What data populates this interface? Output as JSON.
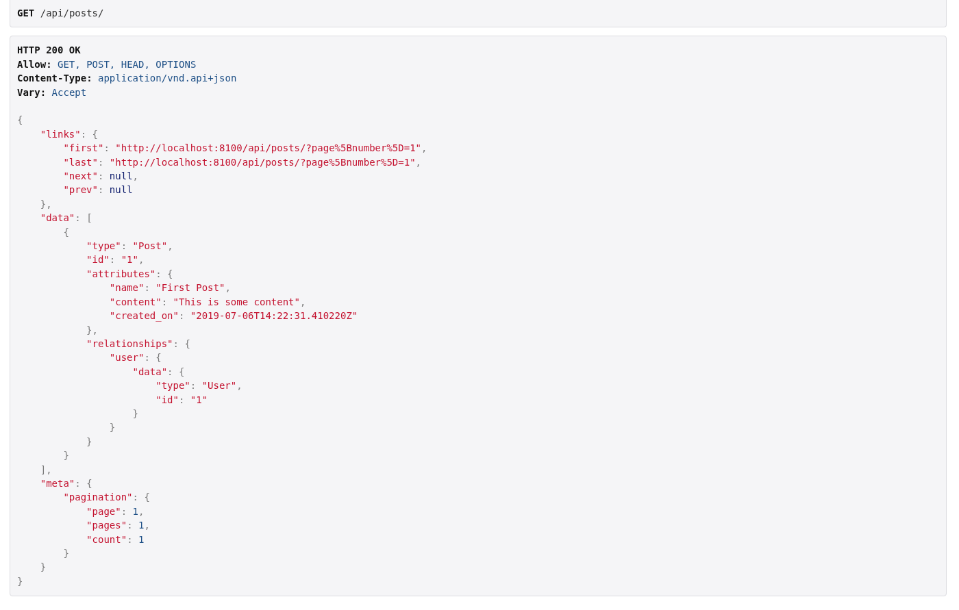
{
  "request": {
    "method": "GET",
    "path": "/api/posts/"
  },
  "response": {
    "status": "HTTP 200 OK",
    "headers": [
      {
        "name": "Allow:",
        "value": "GET, POST, HEAD, OPTIONS"
      },
      {
        "name": "Content-Type:",
        "value": "application/vnd.api+json"
      },
      {
        "name": "Vary:",
        "value": "Accept"
      }
    ],
    "body": {
      "tokens": [
        {
          "kind": "punct",
          "text": "{"
        }
      ],
      "close": [
        {
          "kind": "punct",
          "text": "}"
        }
      ],
      "children": [
        {
          "tokens": [
            {
              "kind": "key",
              "text": "\"links\""
            },
            {
              "kind": "punct",
              "text": ": {"
            }
          ],
          "close": [
            {
              "kind": "punct",
              "text": "},"
            }
          ],
          "children": [
            {
              "tokens": [
                {
                  "kind": "key",
                  "text": "\"first\""
                },
                {
                  "kind": "punct",
                  "text": ": "
                },
                {
                  "kind": "string",
                  "text": "\"http://localhost:8100/api/posts/?page%5Bnumber%5D=1\""
                },
                {
                  "kind": "punct",
                  "text": ","
                }
              ]
            },
            {
              "tokens": [
                {
                  "kind": "key",
                  "text": "\"last\""
                },
                {
                  "kind": "punct",
                  "text": ": "
                },
                {
                  "kind": "string",
                  "text": "\"http://localhost:8100/api/posts/?page%5Bnumber%5D=1\""
                },
                {
                  "kind": "punct",
                  "text": ","
                }
              ]
            },
            {
              "tokens": [
                {
                  "kind": "key",
                  "text": "\"next\""
                },
                {
                  "kind": "punct",
                  "text": ": "
                },
                {
                  "kind": "null",
                  "text": "null"
                },
                {
                  "kind": "punct",
                  "text": ","
                }
              ]
            },
            {
              "tokens": [
                {
                  "kind": "key",
                  "text": "\"prev\""
                },
                {
                  "kind": "punct",
                  "text": ": "
                },
                {
                  "kind": "null",
                  "text": "null"
                }
              ]
            }
          ]
        },
        {
          "tokens": [
            {
              "kind": "key",
              "text": "\"data\""
            },
            {
              "kind": "punct",
              "text": ": ["
            }
          ],
          "close": [
            {
              "kind": "punct",
              "text": "],"
            }
          ],
          "children": [
            {
              "tokens": [
                {
                  "kind": "punct",
                  "text": "{"
                }
              ],
              "close": [
                {
                  "kind": "punct",
                  "text": "}"
                }
              ],
              "children": [
                {
                  "tokens": [
                    {
                      "kind": "key",
                      "text": "\"type\""
                    },
                    {
                      "kind": "punct",
                      "text": ": "
                    },
                    {
                      "kind": "string",
                      "text": "\"Post\""
                    },
                    {
                      "kind": "punct",
                      "text": ","
                    }
                  ]
                },
                {
                  "tokens": [
                    {
                      "kind": "key",
                      "text": "\"id\""
                    },
                    {
                      "kind": "punct",
                      "text": ": "
                    },
                    {
                      "kind": "string",
                      "text": "\"1\""
                    },
                    {
                      "kind": "punct",
                      "text": ","
                    }
                  ]
                },
                {
                  "tokens": [
                    {
                      "kind": "key",
                      "text": "\"attributes\""
                    },
                    {
                      "kind": "punct",
                      "text": ": {"
                    }
                  ],
                  "close": [
                    {
                      "kind": "punct",
                      "text": "},"
                    }
                  ],
                  "children": [
                    {
                      "tokens": [
                        {
                          "kind": "key",
                          "text": "\"name\""
                        },
                        {
                          "kind": "punct",
                          "text": ": "
                        },
                        {
                          "kind": "string",
                          "text": "\"First Post\""
                        },
                        {
                          "kind": "punct",
                          "text": ","
                        }
                      ]
                    },
                    {
                      "tokens": [
                        {
                          "kind": "key",
                          "text": "\"content\""
                        },
                        {
                          "kind": "punct",
                          "text": ": "
                        },
                        {
                          "kind": "string",
                          "text": "\"This is some content\""
                        },
                        {
                          "kind": "punct",
                          "text": ","
                        }
                      ]
                    },
                    {
                      "tokens": [
                        {
                          "kind": "key",
                          "text": "\"created_on\""
                        },
                        {
                          "kind": "punct",
                          "text": ": "
                        },
                        {
                          "kind": "string",
                          "text": "\"2019-07-06T14:22:31.410220Z\""
                        }
                      ]
                    }
                  ]
                },
                {
                  "tokens": [
                    {
                      "kind": "key",
                      "text": "\"relationships\""
                    },
                    {
                      "kind": "punct",
                      "text": ": {"
                    }
                  ],
                  "close": [
                    {
                      "kind": "punct",
                      "text": "}"
                    }
                  ],
                  "children": [
                    {
                      "tokens": [
                        {
                          "kind": "key",
                          "text": "\"user\""
                        },
                        {
                          "kind": "punct",
                          "text": ": {"
                        }
                      ],
                      "close": [
                        {
                          "kind": "punct",
                          "text": "}"
                        }
                      ],
                      "children": [
                        {
                          "tokens": [
                            {
                              "kind": "key",
                              "text": "\"data\""
                            },
                            {
                              "kind": "punct",
                              "text": ": {"
                            }
                          ],
                          "close": [
                            {
                              "kind": "punct",
                              "text": "}"
                            }
                          ],
                          "children": [
                            {
                              "tokens": [
                                {
                                  "kind": "key",
                                  "text": "\"type\""
                                },
                                {
                                  "kind": "punct",
                                  "text": ": "
                                },
                                {
                                  "kind": "string",
                                  "text": "\"User\""
                                },
                                {
                                  "kind": "punct",
                                  "text": ","
                                }
                              ]
                            },
                            {
                              "tokens": [
                                {
                                  "kind": "key",
                                  "text": "\"id\""
                                },
                                {
                                  "kind": "punct",
                                  "text": ": "
                                },
                                {
                                  "kind": "string",
                                  "text": "\"1\""
                                }
                              ]
                            }
                          ]
                        }
                      ]
                    }
                  ]
                }
              ]
            }
          ]
        },
        {
          "tokens": [
            {
              "kind": "key",
              "text": "\"meta\""
            },
            {
              "kind": "punct",
              "text": ": {"
            }
          ],
          "close": [
            {
              "kind": "punct",
              "text": "}"
            }
          ],
          "children": [
            {
              "tokens": [
                {
                  "kind": "key",
                  "text": "\"pagination\""
                },
                {
                  "kind": "punct",
                  "text": ": {"
                }
              ],
              "close": [
                {
                  "kind": "punct",
                  "text": "}"
                }
              ],
              "children": [
                {
                  "tokens": [
                    {
                      "kind": "key",
                      "text": "\"page\""
                    },
                    {
                      "kind": "punct",
                      "text": ": "
                    },
                    {
                      "kind": "number",
                      "text": "1"
                    },
                    {
                      "kind": "punct",
                      "text": ","
                    }
                  ]
                },
                {
                  "tokens": [
                    {
                      "kind": "key",
                      "text": "\"pages\""
                    },
                    {
                      "kind": "punct",
                      "text": ": "
                    },
                    {
                      "kind": "number",
                      "text": "1"
                    },
                    {
                      "kind": "punct",
                      "text": ","
                    }
                  ]
                },
                {
                  "tokens": [
                    {
                      "kind": "key",
                      "text": "\"count\""
                    },
                    {
                      "kind": "punct",
                      "text": ": "
                    },
                    {
                      "kind": "number",
                      "text": "1"
                    }
                  ]
                }
              ]
            }
          ]
        }
      ]
    }
  }
}
